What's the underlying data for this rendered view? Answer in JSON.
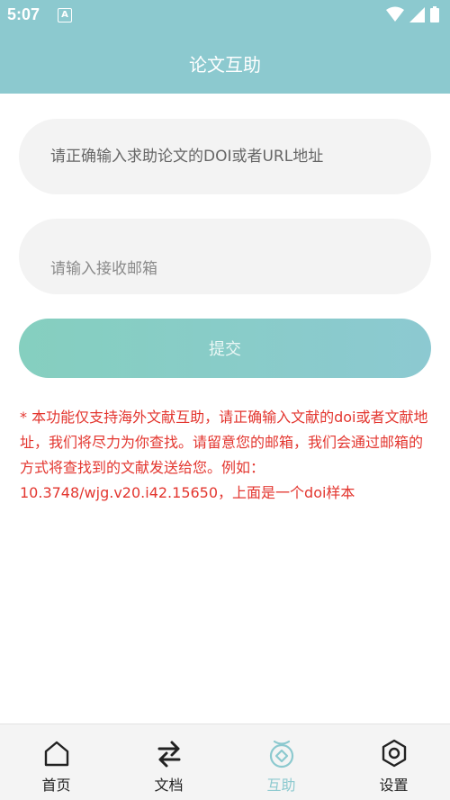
{
  "status_bar": {
    "time": "5:07",
    "notification_letter": "A"
  },
  "header": {
    "title": "论文互助"
  },
  "form": {
    "doi_placeholder": "请正确输入求助论文的DOI或者URL地址",
    "email_placeholder": "请输入接收邮箱",
    "submit_label": "提交"
  },
  "notice": "* 本功能仅支持海外文献互助，请正确输入文献的doi或者文献地址，我们将尽力为你查找。请留意您的邮箱，我们会通过邮箱的方式将查找到的文献发送给您。例如：10.3748/wjg.v20.i42.15650，上面是一个doi样本",
  "tabs": [
    {
      "label": "首页",
      "icon": "home-icon"
    },
    {
      "label": "文档",
      "icon": "swap-arrows-icon"
    },
    {
      "label": "互助",
      "icon": "help-icon",
      "active": true
    },
    {
      "label": "设置",
      "icon": "settings-icon"
    }
  ],
  "colors": {
    "header": "#8cc9cf",
    "notice": "#e3362f",
    "active_tab": "#8cc9cf",
    "field_bg": "#f3f3f3"
  }
}
